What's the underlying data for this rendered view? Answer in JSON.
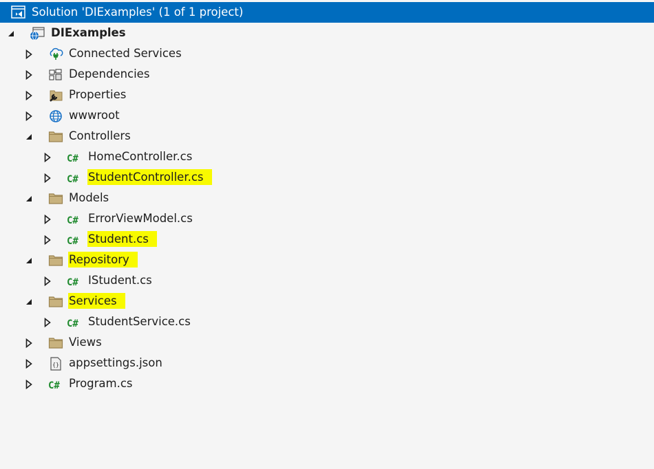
{
  "solution": {
    "title": "Solution 'DIExamples' (1 of 1 project)",
    "icon": "solution-icon"
  },
  "project": {
    "name": "DIExamples",
    "icon": "web-project-icon",
    "expanded": true
  },
  "tree": [
    {
      "label": "Connected Services",
      "icon": "connected-services-icon",
      "level": 1,
      "expanded": false,
      "highlighted": false
    },
    {
      "label": "Dependencies",
      "icon": "dependencies-icon",
      "level": 1,
      "expanded": false,
      "highlighted": false
    },
    {
      "label": "Properties",
      "icon": "properties-folder-icon",
      "level": 1,
      "expanded": false,
      "highlighted": false
    },
    {
      "label": "wwwroot",
      "icon": "globe-icon",
      "level": 1,
      "expanded": false,
      "highlighted": false
    },
    {
      "label": "Controllers",
      "icon": "folder-icon",
      "level": 1,
      "expanded": true,
      "highlighted": false
    },
    {
      "label": "HomeController.cs",
      "icon": "csharp-file-icon",
      "level": 2,
      "expanded": false,
      "highlighted": false
    },
    {
      "label": "StudentController.cs",
      "icon": "csharp-file-icon",
      "level": 2,
      "expanded": false,
      "highlighted": true
    },
    {
      "label": "Models",
      "icon": "folder-icon",
      "level": 1,
      "expanded": true,
      "highlighted": false
    },
    {
      "label": "ErrorViewModel.cs",
      "icon": "csharp-file-icon",
      "level": 2,
      "expanded": false,
      "highlighted": false
    },
    {
      "label": "Student.cs",
      "icon": "csharp-file-icon",
      "level": 2,
      "expanded": false,
      "highlighted": true
    },
    {
      "label": "Repository",
      "icon": "folder-icon",
      "level": 1,
      "expanded": true,
      "highlighted": true
    },
    {
      "label": "IStudent.cs",
      "icon": "csharp-file-icon",
      "level": 2,
      "expanded": false,
      "highlighted": false
    },
    {
      "label": "Services",
      "icon": "folder-icon",
      "level": 1,
      "expanded": true,
      "highlighted": true
    },
    {
      "label": "StudentService.cs",
      "icon": "csharp-file-icon",
      "level": 2,
      "expanded": false,
      "highlighted": false
    },
    {
      "label": "Views",
      "icon": "folder-icon",
      "level": 1,
      "expanded": false,
      "highlighted": false
    },
    {
      "label": "appsettings.json",
      "icon": "json-file-icon",
      "level": 1,
      "expanded": false,
      "highlighted": false
    },
    {
      "label": "Program.cs",
      "icon": "csharp-file-icon",
      "level": 1,
      "expanded": false,
      "highlighted": false
    }
  ],
  "colors": {
    "selection": "#006cbe",
    "highlight": "#f8fa00",
    "csharp": "#1f8a2e",
    "folder": "#c8b27e",
    "background": "#f5f5f5"
  },
  "glyphs": {
    "csharp": "C#"
  }
}
